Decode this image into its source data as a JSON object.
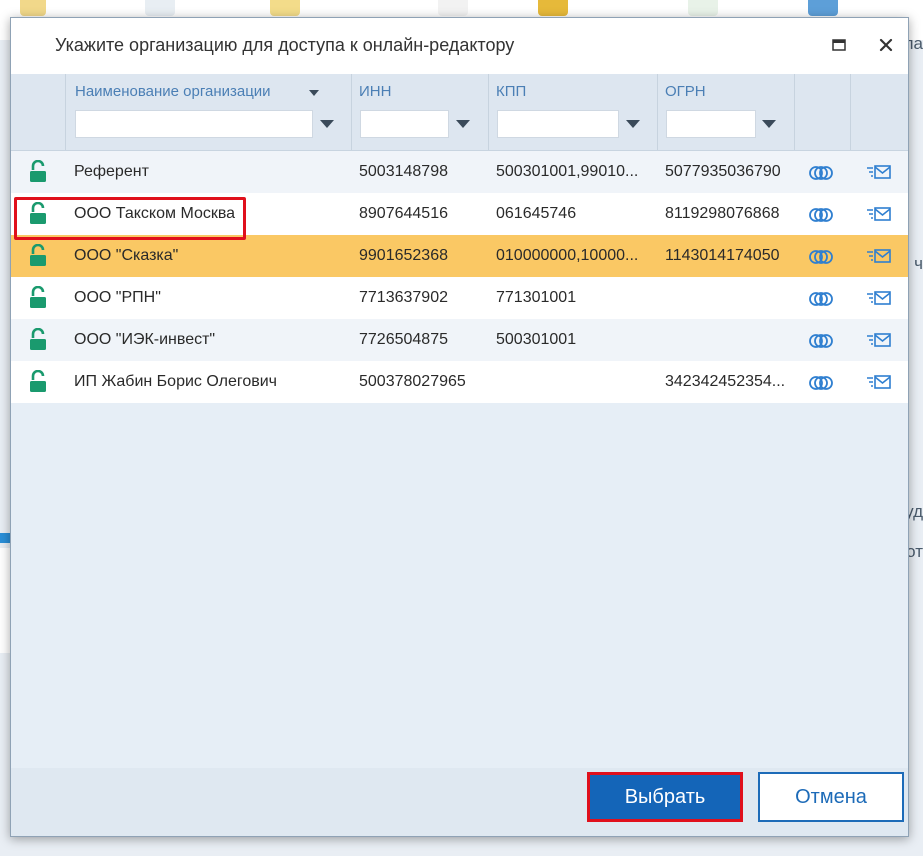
{
  "dialog": {
    "title": "Укажите организацию для доступа к онлайн-редактору"
  },
  "columns": {
    "name": "Наименование организации",
    "inn": "ИНН",
    "kpp": "КПП",
    "ogrn": "ОГРН"
  },
  "filters": {
    "name": "",
    "inn": "",
    "kpp": "",
    "ogrn": ""
  },
  "rows": [
    {
      "name": "Референт",
      "inn": "5003148798",
      "kpp": "500301001,99010...",
      "ogrn": "5077935036790",
      "selected": false
    },
    {
      "name": "ООО Такском Москва",
      "inn": "8907644516",
      "kpp": "061645746",
      "ogrn": "8119298076868",
      "selected": false
    },
    {
      "name": "ООО \"Сказка\"",
      "inn": "9901652368",
      "kpp": "010000000,10000...",
      "ogrn": "1143014174050",
      "selected": true
    },
    {
      "name": "ООО \"РПН\"",
      "inn": "7713637902",
      "kpp": "771301001",
      "ogrn": "",
      "selected": false
    },
    {
      "name": "ООО \"ИЭК-инвест\"",
      "inn": "7726504875",
      "kpp": "500301001",
      "ogrn": "",
      "selected": false
    },
    {
      "name": "ИП Жабин Борис Олегович",
      "inn": "500378027965",
      "kpp": "",
      "ogrn": "342342452354...",
      "selected": false
    }
  ],
  "buttons": {
    "select": "Выбрать",
    "cancel": "Отмена"
  },
  "background": {
    "right_edge_text": [
      "ла",
      "ч",
      "уд",
      "от"
    ]
  },
  "colors": {
    "selected_row": "#fac864",
    "highlight": "#e0101c",
    "primary": "#1465b8",
    "lock_icon": "#1a9a6e",
    "action_icon": "#2f7fd0"
  },
  "icons": {
    "row_lock": "unlock-icon",
    "row_link": "link-icon",
    "row_mail": "mail-icon",
    "maximize": "maximize-icon",
    "close": "close-icon",
    "sort": "sort-desc-icon",
    "filter": "chevron-down-icon"
  }
}
